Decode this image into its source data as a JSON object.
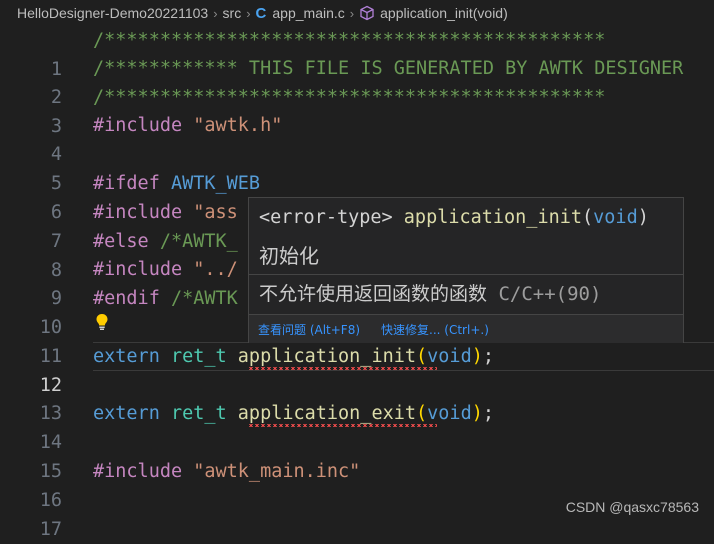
{
  "breadcrumb": {
    "project": "HelloDesigner-Demo20221103",
    "folder": "src",
    "file_icon": "C",
    "file": "app_main.c",
    "symbol": "application_init(void)"
  },
  "code": {
    "line_numbers": [
      "1",
      "2",
      "3",
      "4",
      "5",
      "6",
      "7",
      "8",
      "9",
      "10",
      "11",
      "12",
      "13",
      "14",
      "15",
      "16",
      "17"
    ],
    "line1": "/*********************************************",
    "line2_stars": "/************",
    "line2_text": " THIS FILE IS GENERATED BY AWTK DESIGNER",
    "line3": "/*********************************************",
    "line4_kw": "#include",
    "line4_str": " \"awtk.h\"",
    "line6_kw": "#ifdef",
    "line6_id": " AWTK_WEB",
    "line7_kw": "#include",
    "line7_str": " \"ass",
    "line8_kw": "#else",
    "line8_cmt": " /*AWTK_",
    "line9_kw": "#include",
    "line9_str": " \"../",
    "line10_kw": "#endif",
    "line10_cmt": " /*AWTK",
    "line12_kw": "extern",
    "line12_type": " ret_t",
    "line12_fn": " application_init",
    "line12_open": "(",
    "line12_void": "void",
    "line12_close": ")",
    "line12_semi": ";",
    "line14_kw": "extern",
    "line14_type": " ret_t",
    "line14_fn": " application_exit",
    "line14_open": "(",
    "line14_void": "void",
    "line14_close": ")",
    "line14_semi": ";",
    "line16_kw": "#include",
    "line16_str": " \"awtk_main.inc\""
  },
  "hover": {
    "signature_type": "<error-type>",
    "signature_fn": " application_init",
    "signature_open": "(",
    "signature_void": "void",
    "signature_close": ")",
    "description": "初始化",
    "error_message": "不允许使用返回函数的函数",
    "error_source": " C/C++(90)",
    "action_view_problem": "查看问题 (Alt+F8)",
    "action_quick_fix": "快速修复... (Ctrl+.)"
  },
  "watermark": "CSDN @qasxc78563",
  "colors": {
    "background": "#1f1f1f",
    "comment": "#6a9955",
    "keyword": "#569cd6",
    "preprocessor": "#c586c0",
    "string": "#ce9178",
    "type": "#4ec9b0",
    "function": "#dcdcaa",
    "error_squiggle": "#f14c4c",
    "link": "#3794ff"
  },
  "icons": {
    "breadcrumb_separator": "chevron-right-icon",
    "file_type": "c-language-icon",
    "symbol": "method-cube-icon",
    "code_action": "lightbulb-icon"
  }
}
